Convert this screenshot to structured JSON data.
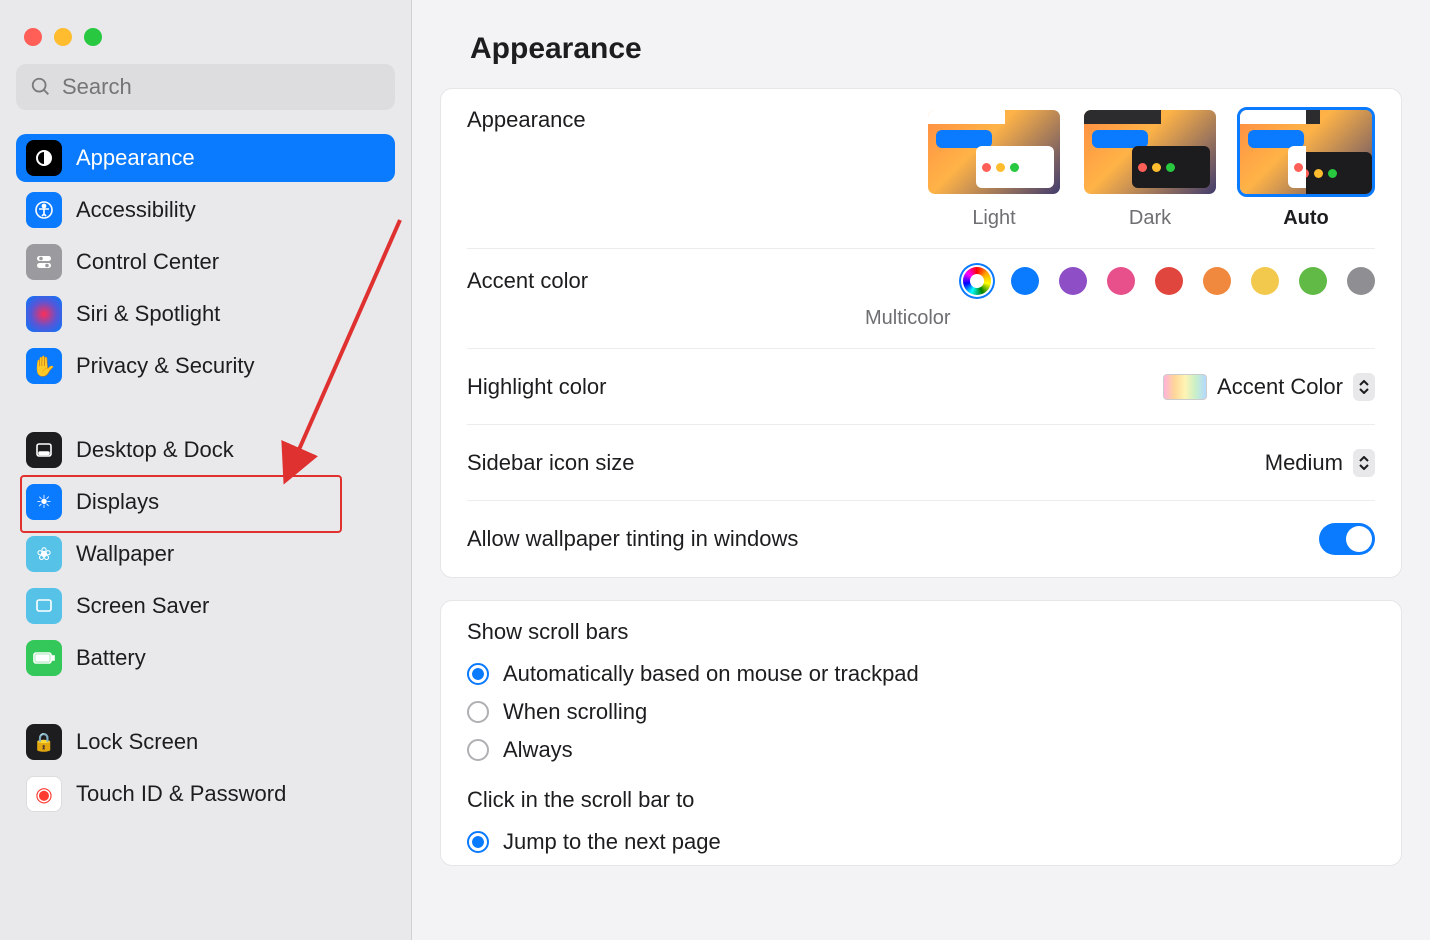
{
  "search": {
    "placeholder": "Search"
  },
  "sidebar": {
    "items": [
      {
        "label": "Appearance",
        "icon_bg": "#000000",
        "selected": true
      },
      {
        "label": "Accessibility",
        "icon_bg": "#0a7aff"
      },
      {
        "label": "Control Center",
        "icon_bg": "#9b9b9f"
      },
      {
        "label": "Siri & Spotlight",
        "icon_bg": "#1d1d1f"
      },
      {
        "label": "Privacy & Security",
        "icon_bg": "#0a7aff"
      },
      {
        "label": "Desktop & Dock",
        "icon_bg": "#1d1d1f"
      },
      {
        "label": "Displays",
        "icon_bg": "#0a7aff"
      },
      {
        "label": "Wallpaper",
        "icon_bg": "#57c2e8"
      },
      {
        "label": "Screen Saver",
        "icon_bg": "#57c2e8"
      },
      {
        "label": "Battery",
        "icon_bg": "#34c759"
      },
      {
        "label": "Lock Screen",
        "icon_bg": "#1d1d1f"
      },
      {
        "label": "Touch ID & Password",
        "icon_bg": "#ffffff"
      }
    ]
  },
  "page": {
    "title": "Appearance",
    "appearance_label": "Appearance",
    "themes": [
      {
        "label": "Light",
        "selected": false
      },
      {
        "label": "Dark",
        "selected": false
      },
      {
        "label": "Auto",
        "selected": true
      }
    ],
    "accent_label": "Accent color",
    "accent_caption": "Multicolor",
    "accent_colors": [
      {
        "name": "multicolor",
        "hex": "multi",
        "selected": true
      },
      {
        "name": "blue",
        "hex": "#0a7aff"
      },
      {
        "name": "purple",
        "hex": "#8e4ec6"
      },
      {
        "name": "pink",
        "hex": "#e7508b"
      },
      {
        "name": "red",
        "hex": "#e0463e"
      },
      {
        "name": "orange",
        "hex": "#f0883e"
      },
      {
        "name": "yellow",
        "hex": "#f2c94c"
      },
      {
        "name": "green",
        "hex": "#62ba46"
      },
      {
        "name": "graphite",
        "hex": "#8e8e93"
      }
    ],
    "highlight_label": "Highlight color",
    "highlight_value": "Accent Color",
    "sidebar_icon_label": "Sidebar icon size",
    "sidebar_icon_value": "Medium",
    "tinting_label": "Allow wallpaper tinting in windows",
    "tinting_on": true,
    "scroll_title": "Show scroll bars",
    "scroll_options": [
      {
        "label": "Automatically based on mouse or trackpad",
        "checked": true
      },
      {
        "label": "When scrolling",
        "checked": false
      },
      {
        "label": "Always",
        "checked": false
      }
    ],
    "click_title": "Click in the scroll bar to",
    "click_options": [
      {
        "label": "Jump to the next page",
        "checked": true
      }
    ]
  }
}
